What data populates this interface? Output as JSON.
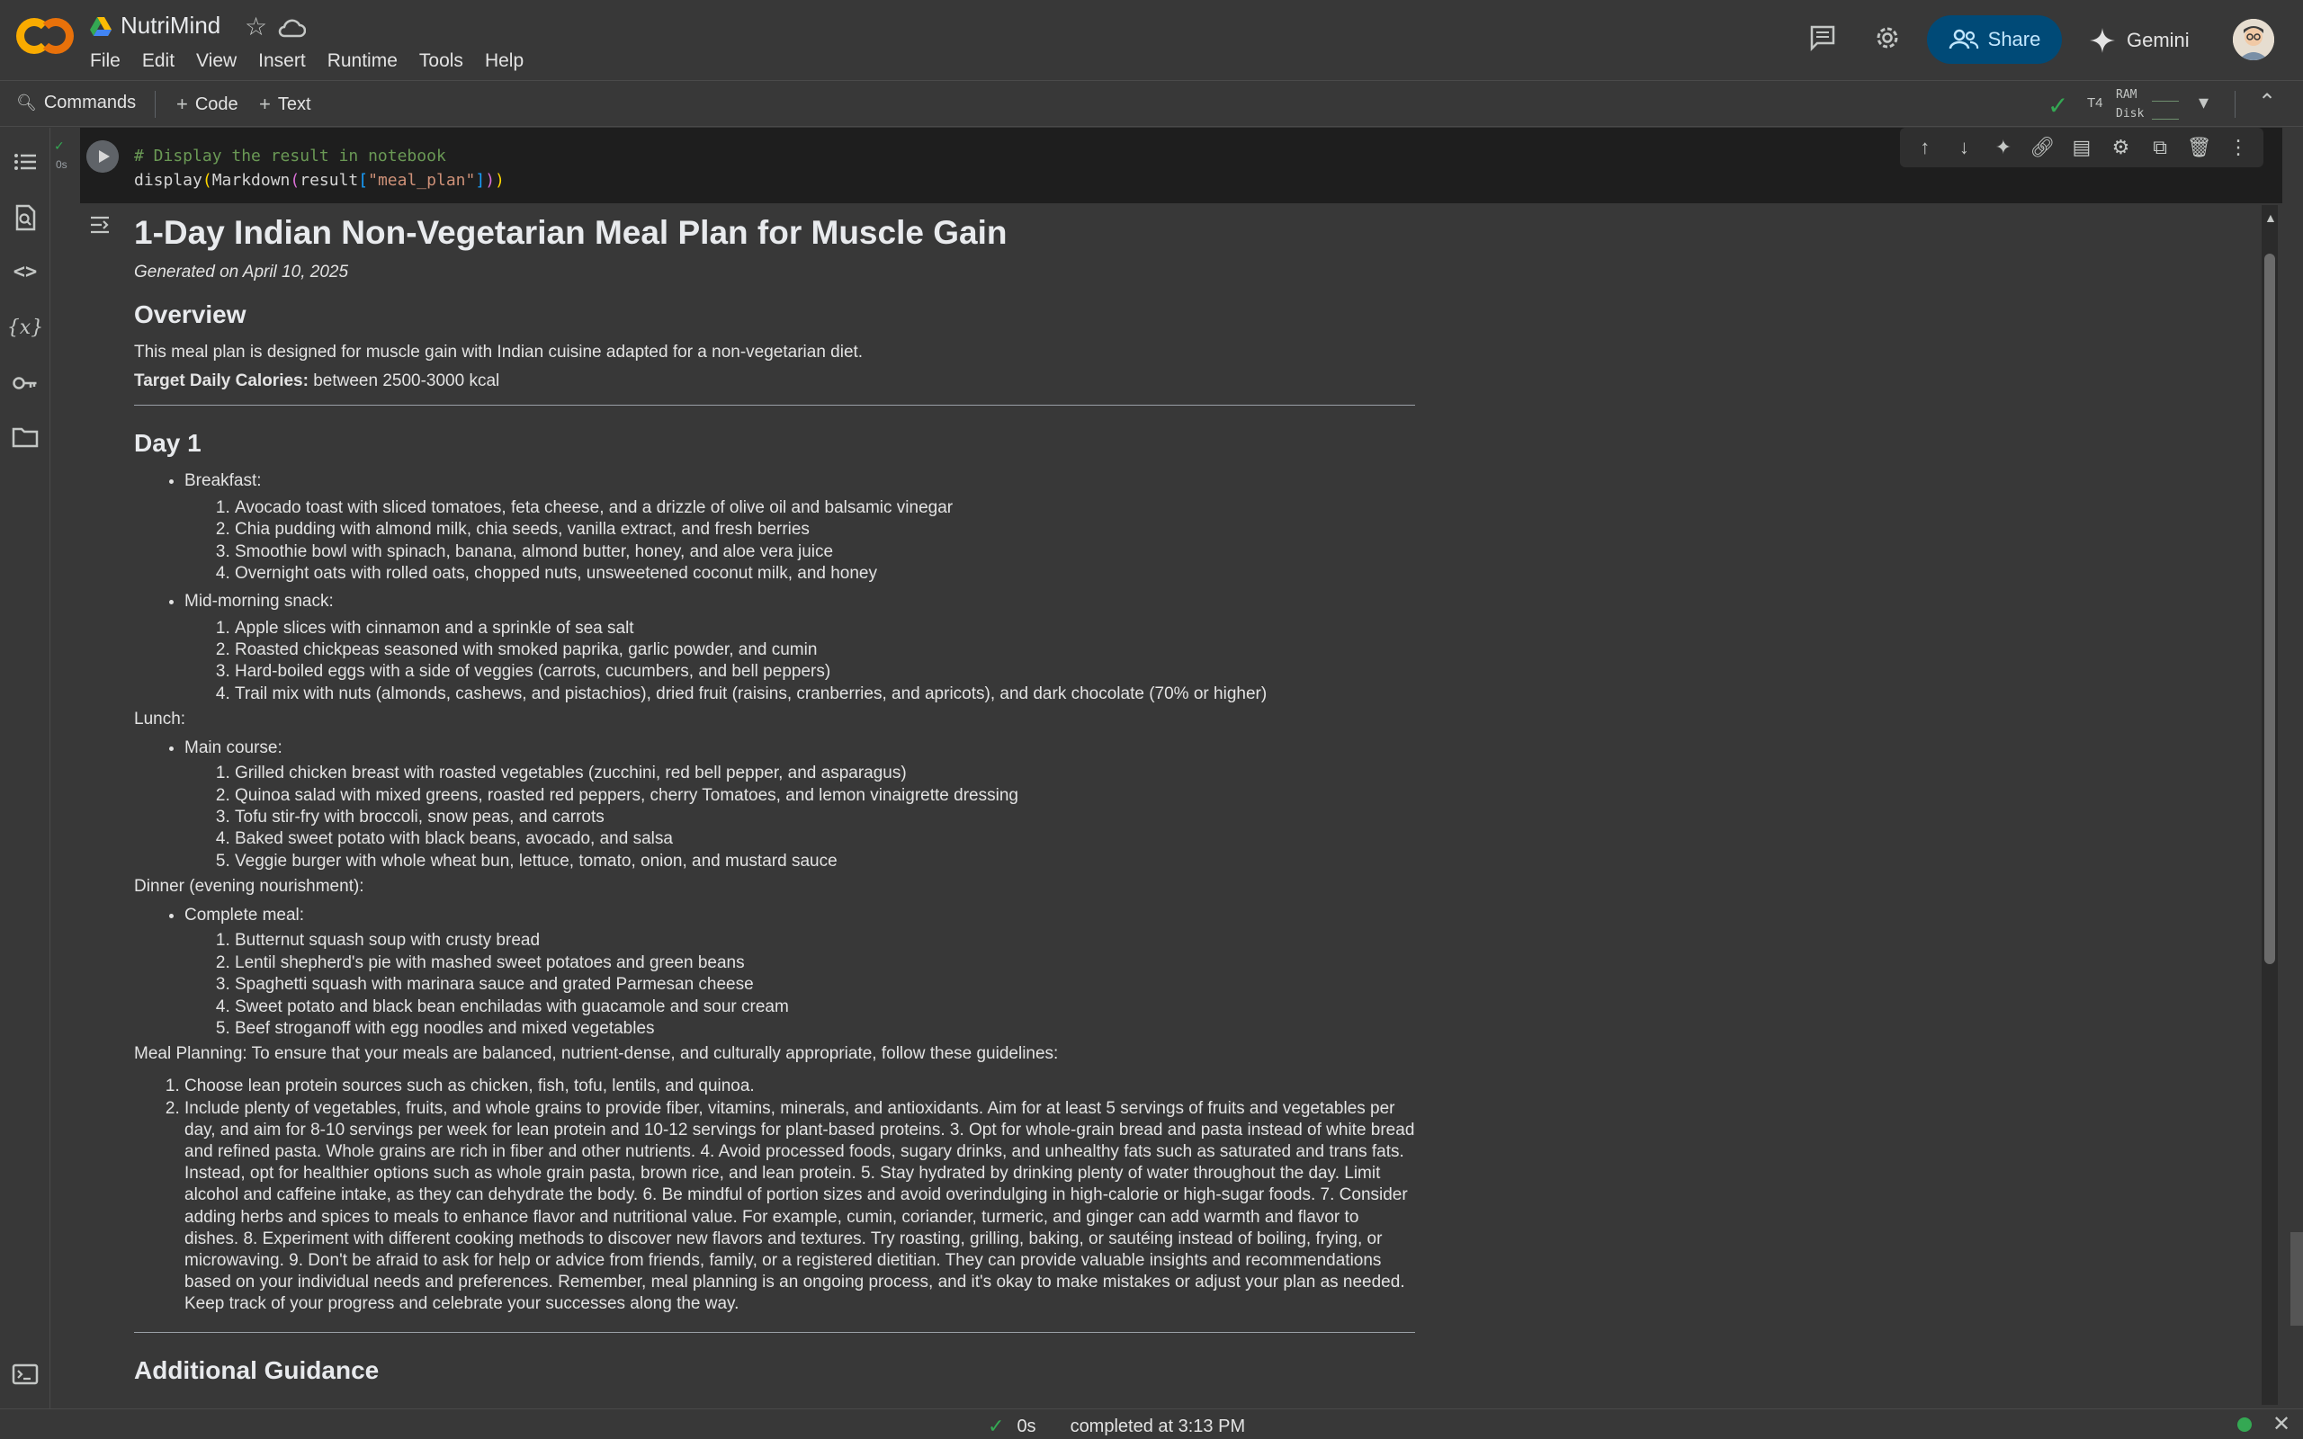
{
  "header": {
    "title": "NutriMind",
    "menu": [
      "File",
      "Edit",
      "View",
      "Insert",
      "Runtime",
      "Tools",
      "Help"
    ],
    "share_label": "Share",
    "gemini_label": "Gemini"
  },
  "toolbar": {
    "commands_label": "Commands",
    "code_label": "Code",
    "text_label": "Text",
    "runtime_type": "T4",
    "ram_label": "RAM",
    "disk_label": "Disk"
  },
  "cell": {
    "exec_time": "0s",
    "code_line1": "# Display the result in notebook",
    "code_fn": "display",
    "code_md": "Markdown",
    "code_result": "result",
    "code_key": "\"meal_plan\""
  },
  "output": {
    "title": "1-Day Indian Non-Vegetarian Meal Plan for Muscle Gain",
    "generated": "Generated on April 10, 2025",
    "overview_heading": "Overview",
    "overview_text": "This meal plan is designed for muscle gain with Indian cuisine adapted for a non-vegetarian diet.",
    "calories_label": "Target Daily Calories:",
    "calories_value": "between 2500-3000 kcal",
    "day_heading": "Day 1",
    "breakfast_label": "Breakfast:",
    "breakfast": [
      "Avocado toast with sliced tomatoes, feta cheese, and a drizzle of olive oil and balsamic vinegar",
      "Chia pudding with almond milk, chia seeds, vanilla extract, and fresh berries",
      "Smoothie bowl with spinach, banana, almond butter, honey, and aloe vera juice",
      "Overnight oats with rolled oats, chopped nuts, unsweetened coconut milk, and honey"
    ],
    "snack_label": "Mid-morning snack:",
    "snack": [
      "Apple slices with cinnamon and a sprinkle of sea salt",
      "Roasted chickpeas seasoned with smoked paprika, garlic powder, and cumin",
      "Hard-boiled eggs with a side of veggies (carrots, cucumbers, and bell peppers)",
      "Trail mix with nuts (almonds, cashews, and pistachios), dried fruit (raisins, cranberries, and apricots), and dark chocolate (70% or higher)"
    ],
    "lunch_label": "Lunch:",
    "main_course_label": "Main course:",
    "lunch": [
      "Grilled chicken breast with roasted vegetables (zucchini, red bell pepper, and asparagus)",
      "Quinoa salad with mixed greens, roasted red peppers, cherry Tomatoes, and lemon vinaigrette dressing",
      "Tofu stir-fry with broccoli, snow peas, and carrots",
      "Baked sweet potato with black beans, avocado, and salsa",
      "Veggie burger with whole wheat bun, lettuce, tomato, onion, and mustard sauce"
    ],
    "dinner_label": "Dinner (evening nourishment):",
    "complete_meal_label": "Complete meal:",
    "dinner": [
      "Butternut squash soup with crusty bread",
      "Lentil shepherd's pie with mashed sweet potatoes and green beans",
      "Spaghetti squash with marinara sauce and grated Parmesan cheese",
      "Sweet potato and black bean enchiladas with guacamole and sour cream",
      "Beef stroganoff with egg noodles and mixed vegetables"
    ],
    "planning_intro": "Meal Planning: To ensure that your meals are balanced, nutrient-dense, and culturally appropriate, follow these guidelines:",
    "planning": [
      "Choose lean protein sources such as chicken, fish, tofu, lentils, and quinoa.",
      "Include plenty of vegetables, fruits, and whole grains to provide fiber, vitamins, minerals, and antioxidants. Aim for at least 5 servings of fruits and vegetables per day, and aim for 8-10 servings per week for lean protein and 10-12 servings for plant-based proteins. 3. Opt for whole-grain bread and pasta instead of white bread and refined pasta. Whole grains are rich in fiber and other nutrients. 4. Avoid processed foods, sugary drinks, and unhealthy fats such as saturated and trans fats. Instead, opt for healthier options such as whole grain pasta, brown rice, and lean protein. 5. Stay hydrated by drinking plenty of water throughout the day. Limit alcohol and caffeine intake, as they can dehydrate the body. 6. Be mindful of portion sizes and avoid overindulging in high-calorie or high-sugar foods. 7. Consider adding herbs and spices to meals to enhance flavor and nutritional value. For example, cumin, coriander, turmeric, and ginger can add warmth and flavor to dishes. 8. Experiment with different cooking methods to discover new flavors and textures. Try roasting, grilling, baking, or sautéing instead of boiling, frying, or microwaving. 9. Don't be afraid to ask for help or advice from friends, family, or a registered dietitian. They can provide valuable insights and recommendations based on your individual needs and preferences. Remember, meal planning is an ongoing process, and it's okay to make mistakes or adjust your plan as needed. Keep track of your progress and celebrate your successes along the way."
    ],
    "additional_heading": "Additional Guidance"
  },
  "status": {
    "duration": "0s",
    "completed": "completed at 3:13 PM"
  },
  "colors": {
    "accent": "#004a77",
    "success": "#34a853",
    "logo_yellow": "#f9ab00",
    "logo_orange": "#e8710a"
  }
}
